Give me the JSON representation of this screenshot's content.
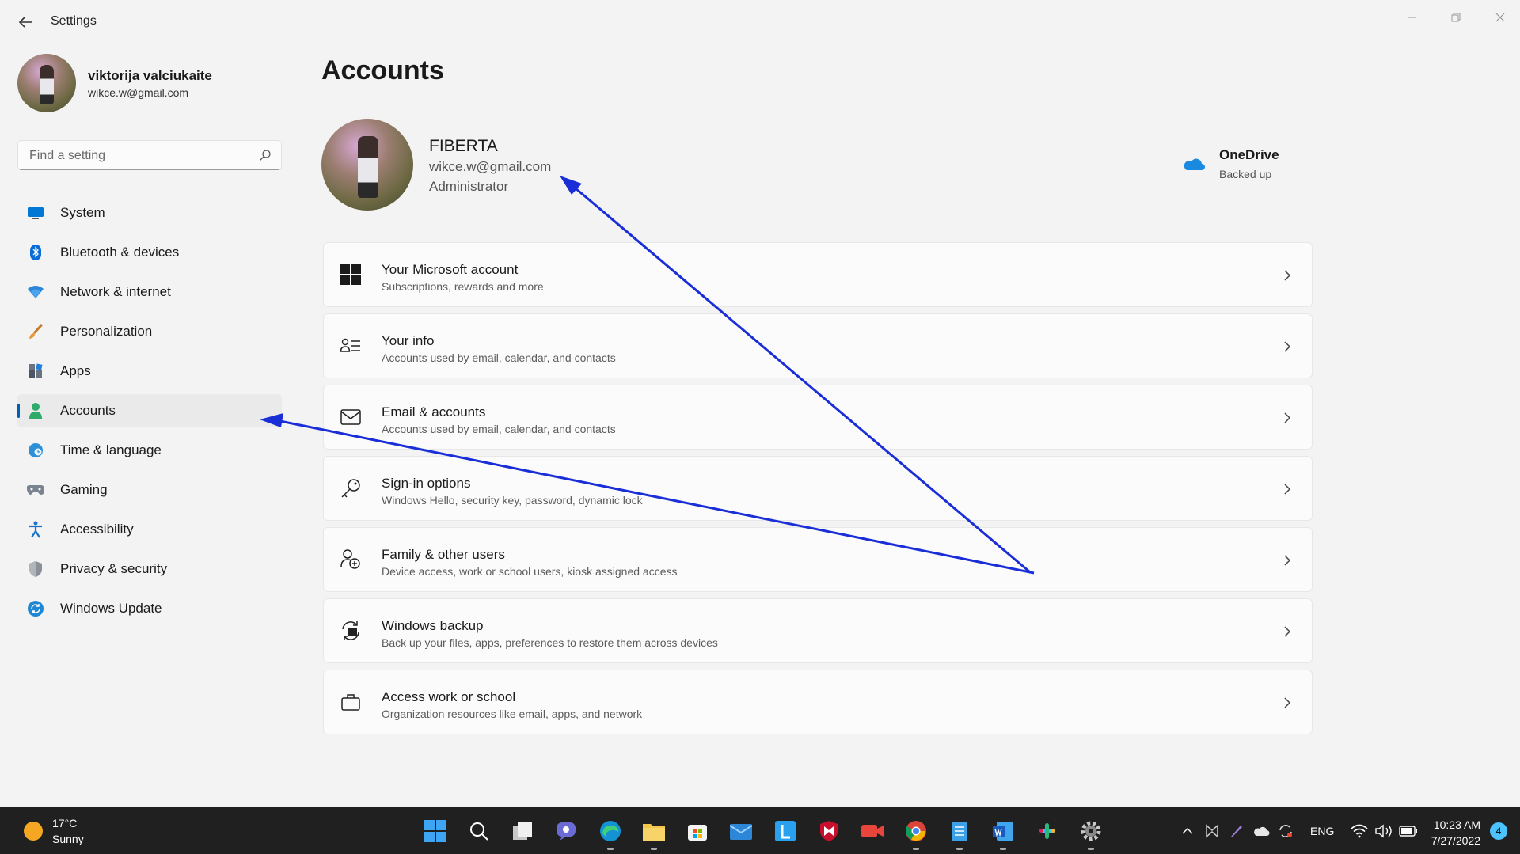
{
  "window": {
    "title": "Settings"
  },
  "sidebar": {
    "profile_name": "viktorija valciukaite",
    "profile_email": "wikce.w@gmail.com",
    "search_placeholder": "Find a setting",
    "items": [
      {
        "label": "System",
        "icon": "monitor-icon",
        "active": false
      },
      {
        "label": "Bluetooth & devices",
        "icon": "bluetooth-icon",
        "active": false
      },
      {
        "label": "Network & internet",
        "icon": "wifi-icon",
        "active": false
      },
      {
        "label": "Personalization",
        "icon": "paintbrush-icon",
        "active": false
      },
      {
        "label": "Apps",
        "icon": "apps-icon",
        "active": false
      },
      {
        "label": "Accounts",
        "icon": "person-icon",
        "active": true
      },
      {
        "label": "Time & language",
        "icon": "globe-clock-icon",
        "active": false
      },
      {
        "label": "Gaming",
        "icon": "gamepad-icon",
        "active": false
      },
      {
        "label": "Accessibility",
        "icon": "accessibility-icon",
        "active": false
      },
      {
        "label": "Privacy & security",
        "icon": "shield-icon",
        "active": false
      },
      {
        "label": "Windows Update",
        "icon": "update-icon",
        "active": false
      }
    ]
  },
  "main": {
    "title": "Accounts",
    "account": {
      "name": "FIBERTA",
      "email": "wikce.w@gmail.com",
      "role": "Administrator"
    },
    "onedrive": {
      "name": "OneDrive",
      "status": "Backed up"
    },
    "cards": [
      {
        "title": "Your Microsoft account",
        "subtitle": "Subscriptions, rewards and more",
        "icon": "windows-logo-icon"
      },
      {
        "title": "Your info",
        "subtitle": "Accounts used by email, calendar, and contacts",
        "icon": "person-list-icon"
      },
      {
        "title": "Email & accounts",
        "subtitle": "Accounts used by email, calendar, and contacts",
        "icon": "mail-icon"
      },
      {
        "title": "Sign-in options",
        "subtitle": "Windows Hello, security key, password, dynamic lock",
        "icon": "key-icon"
      },
      {
        "title": "Family & other users",
        "subtitle": "Device access, work or school users, kiosk assigned access",
        "icon": "person-add-icon"
      },
      {
        "title": "Windows backup",
        "subtitle": "Back up your files, apps, preferences to restore them across devices",
        "icon": "backup-icon"
      },
      {
        "title": "Access work or school",
        "subtitle": "Organization resources like email, apps, and network",
        "icon": "briefcase-icon"
      }
    ]
  },
  "annotation_color": "#1a2ed8",
  "taskbar": {
    "weather_temp": "17°C",
    "weather_condition": "Sunny",
    "language": "ENG",
    "time": "10:23 AM",
    "date": "7/27/2022",
    "notification_count": "4"
  }
}
